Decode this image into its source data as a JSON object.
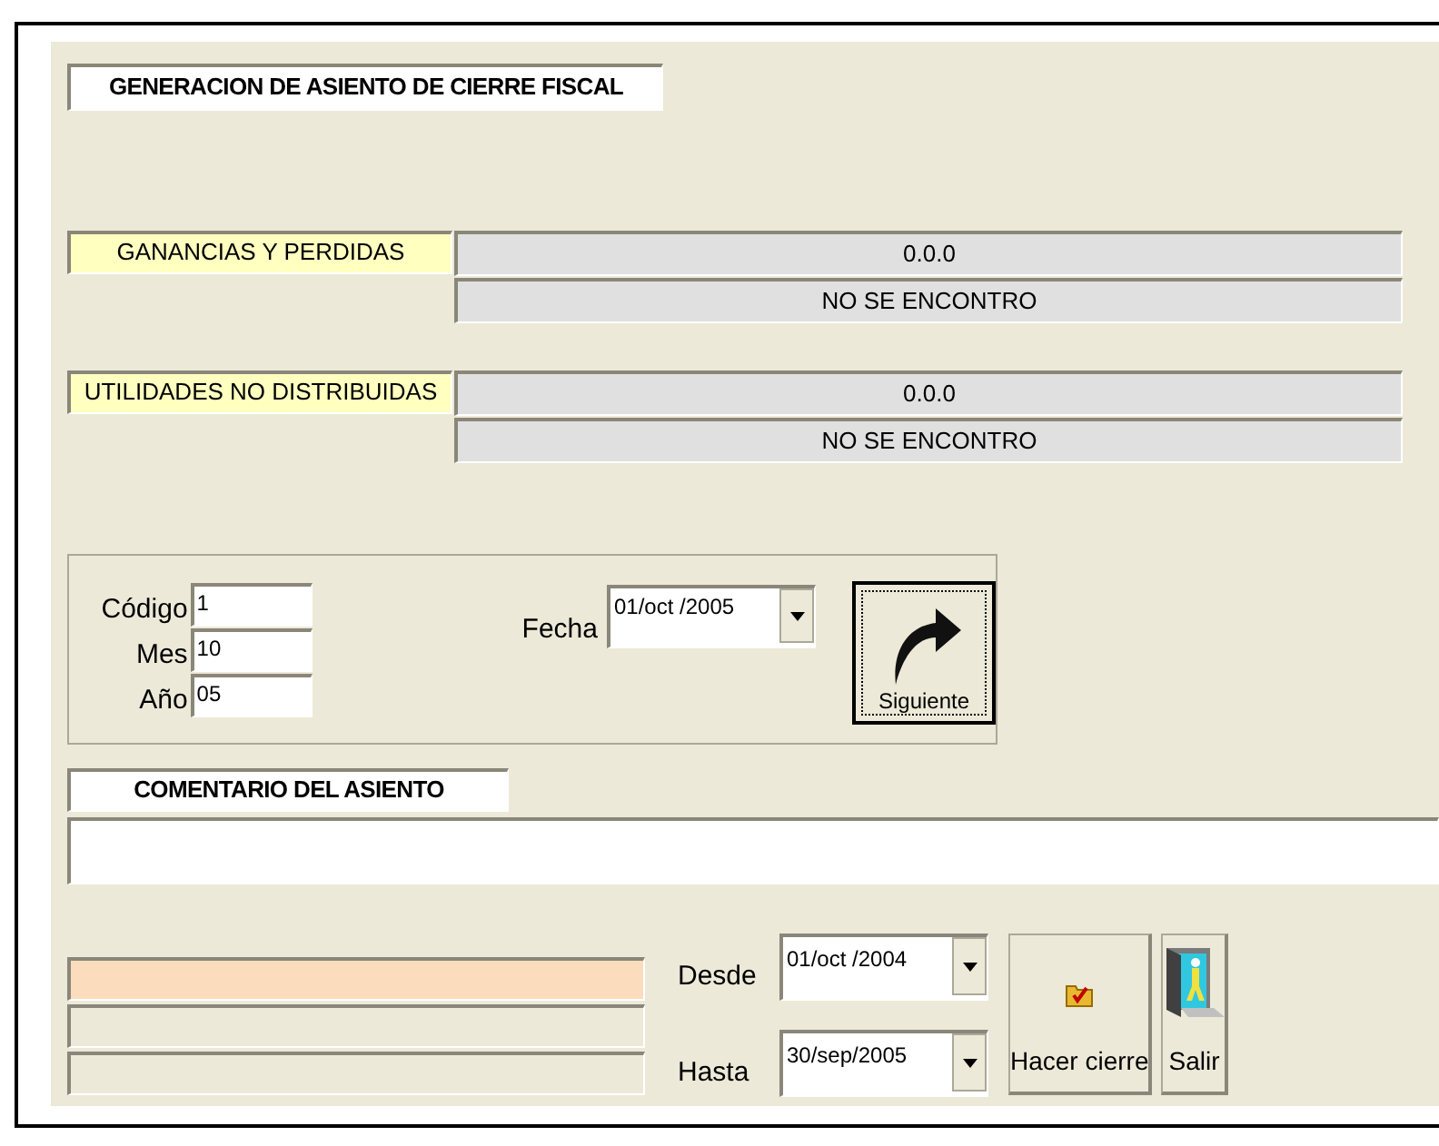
{
  "title": "GENERACION DE ASIENTO DE CIERRE FISCAL",
  "accounts": [
    {
      "label": "GANANCIAS Y PERDIDAS",
      "value": "0.0.0",
      "status": "NO SE ENCONTRO"
    },
    {
      "label": "UTILIDADES NO DISTRIBUIDAS",
      "value": "0.0.0",
      "status": "NO SE ENCONTRO"
    }
  ],
  "entry_fields": [
    {
      "label": "Código",
      "value": "1"
    },
    {
      "label": "Mes",
      "value": "10"
    },
    {
      "label": "Año",
      "value": "05"
    }
  ],
  "fecha": {
    "label": "Fecha",
    "value": "01/oct /2005"
  },
  "next_button": {
    "label": "Siguiente"
  },
  "comment": {
    "label": "COMENTARIO DEL ASIENTO"
  },
  "progress_fields": [
    {
      "highlighted": true
    },
    {
      "highlighted": false
    },
    {
      "highlighted": false
    }
  ],
  "date_range": [
    {
      "label": "Desde",
      "value": "01/oct /2004"
    },
    {
      "label": "Hasta",
      "value": "30/sep/2005"
    }
  ],
  "buttons": [
    {
      "kind": "close",
      "label": "Hacer cierre"
    },
    {
      "kind": "exit",
      "label": "Salir"
    }
  ]
}
